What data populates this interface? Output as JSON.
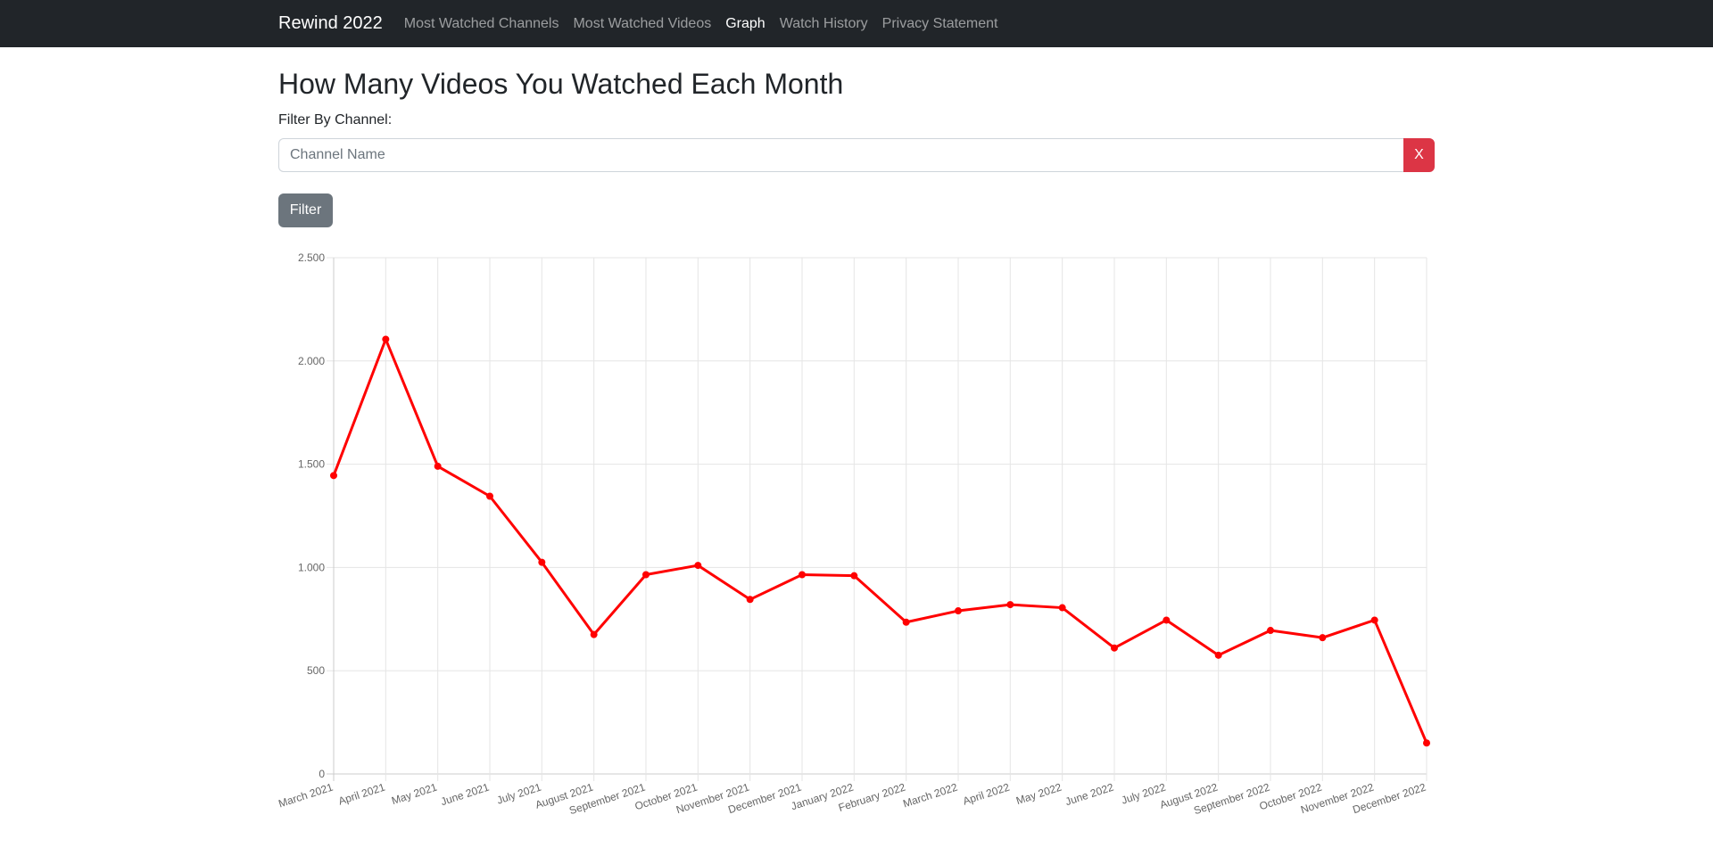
{
  "navbar": {
    "brand": "Rewind 2022",
    "links": [
      {
        "label": "Most Watched Channels",
        "active": false
      },
      {
        "label": "Most Watched Videos",
        "active": false
      },
      {
        "label": "Graph",
        "active": true
      },
      {
        "label": "Watch History",
        "active": false
      },
      {
        "label": "Privacy Statement",
        "active": false
      }
    ]
  },
  "page": {
    "title": "How Many Videos You Watched Each Month",
    "filter_label": "Filter By Channel:",
    "channel_placeholder": "Channel Name",
    "channel_value": "",
    "clear_label": "X",
    "filter_button_label": "Filter"
  },
  "colors": {
    "navbar_bg": "#212529",
    "line": "#ff0000",
    "clear_button": "#dc3545",
    "filter_button": "#6c757d",
    "grid": "#e5e5e5"
  },
  "chart_data": {
    "type": "line",
    "title": "",
    "xlabel": "",
    "ylabel": "",
    "categories": [
      "March 2021",
      "April 2021",
      "May 2021",
      "June 2021",
      "July 2021",
      "August 2021",
      "September 2021",
      "October 2021",
      "November 2021",
      "December 2021",
      "January 2022",
      "February 2022",
      "March 2022",
      "April 2022",
      "May 2022",
      "June 2022",
      "July 2022",
      "August 2022",
      "September 2022",
      "October 2022",
      "November 2022",
      "December 2022"
    ],
    "series": [
      {
        "values": [
          1445,
          2105,
          1490,
          1345,
          1025,
          675,
          965,
          1010,
          845,
          965,
          960,
          735,
          790,
          820,
          805,
          610,
          745,
          575,
          695,
          660,
          745,
          150
        ]
      }
    ],
    "ylim": [
      0,
      2500
    ],
    "yticks": [
      0,
      500,
      1000,
      1500,
      2000,
      2500
    ],
    "ytick_labels": [
      "0",
      "500",
      "1.000",
      "1.500",
      "2.000",
      "2.500"
    ],
    "grid": true,
    "legend": false
  }
}
